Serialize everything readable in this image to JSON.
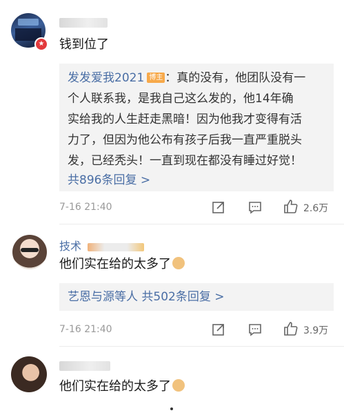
{
  "comment1": {
    "text": "钱到位了",
    "reply_box": {
      "reply_author": "发发爱我2021",
      "author_badge": "博主",
      "reply_text_l1": "：真的没有，他团队没有一",
      "reply_text_l2": "个人联系我，是我自己这么发的，他14年确",
      "reply_text_l3": "实给我的人生赶走黑暗！因为他我才变得有活",
      "reply_text_l4": "力了，但因为他公布有孩子后我一直严重脱头",
      "reply_text_l5": "发，已经秃头！一直到现在都没有睡过好觉！",
      "more_replies": "共896条回复 >"
    },
    "time": "7-16 21:40",
    "likes": "2.6万"
  },
  "comment2": {
    "author": "技术",
    "text": "他们实在给的太多了",
    "reply_box": {
      "replier": "艺恩与源等人",
      "more_replies": "共502条回复 >"
    },
    "time": "7-16 21:40",
    "likes": "3.9万"
  },
  "comment3": {
    "text": "他们实在给的太多了"
  },
  "colors": {
    "link_blue": "#4a6ea5",
    "badge_orange": "#f7a94a",
    "reply_bg": "#f3f3f3"
  }
}
